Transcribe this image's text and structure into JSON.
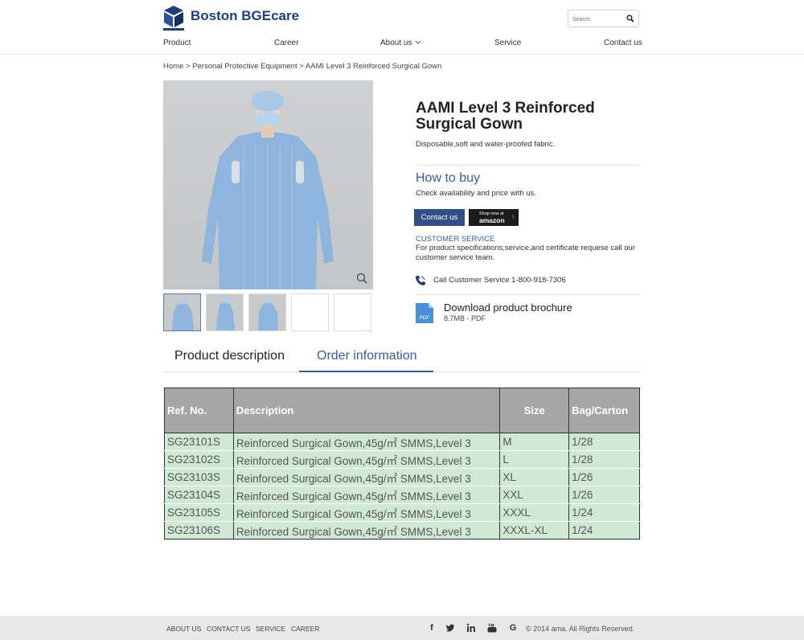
{
  "header": {
    "brand": "Boston BGEcare",
    "search_placeholder": "Search"
  },
  "nav": {
    "items": [
      "Product",
      "Career",
      "About us",
      "Service",
      "Contact us"
    ]
  },
  "breadcrumb": "Home > Personal Protective Equipment > AAMI Level 3 Reinforced Surgical Gown",
  "product": {
    "title": "AAMI Level 3 Reinforced Surgical Gown",
    "subtitle": "Disposable,soft and water-proofed fabric."
  },
  "buy": {
    "title": "How to buy",
    "subtitle": "Check availability and price with us.",
    "contact_label": "Contact us",
    "amazon_line1": "Shop now at",
    "amazon_line2": "amazon"
  },
  "customer_service": {
    "title": "CUSTOMER SERVICE",
    "text": "For product specifications,service,and certificate requese call our customer service team.",
    "phone": "Call Customer Service 1-800-918-7306"
  },
  "brochure": {
    "title": "Download product brochure",
    "meta": "8.7MB - PDF",
    "icon_label": "PDF"
  },
  "tabs": [
    "Product description",
    "Order information"
  ],
  "table": {
    "headers": [
      "Ref. No.",
      "Description",
      "Size",
      "Bag/Carton"
    ],
    "rows": [
      [
        "SG23101S",
        "Reinforced Surgical Gown,45g/㎡ SMMS,Level 3",
        "M",
        "1/28"
      ],
      [
        "SG23102S",
        "Reinforced Surgical Gown,45g/㎡ SMMS,Level 3",
        "L",
        "1/28"
      ],
      [
        "SG23103S",
        "Reinforced Surgical Gown,45g/㎡ SMMS,Level 3",
        "XL",
        "1/26"
      ],
      [
        "SG23104S",
        "Reinforced Surgical Gown,45g/㎡ SMMS,Level 3",
        "XXL",
        "1/26"
      ],
      [
        "SG23105S",
        "Reinforced Surgical Gown,45g/㎡ SMMS,Level 3",
        "XXXL",
        "1/24"
      ],
      [
        "SG23106S",
        "Reinforced Surgical Gown,45g/㎡ SMMS,Level 3",
        "XXXL-XL",
        "1/24"
      ]
    ]
  },
  "footer": {
    "links": [
      "ABOUT US",
      "CONTACT US",
      "SERVICE",
      "CAREER"
    ],
    "social_glyphs": [
      "f",
      "t",
      "in",
      "yt",
      "G"
    ],
    "copyright": "© 2014 ama. All Rights Reserved."
  },
  "colors": {
    "brand_blue": "#1f3f7a",
    "accent_blue": "#3a5a9b",
    "table_header": "#a6a6a6",
    "table_row": "#cfe9d5"
  }
}
